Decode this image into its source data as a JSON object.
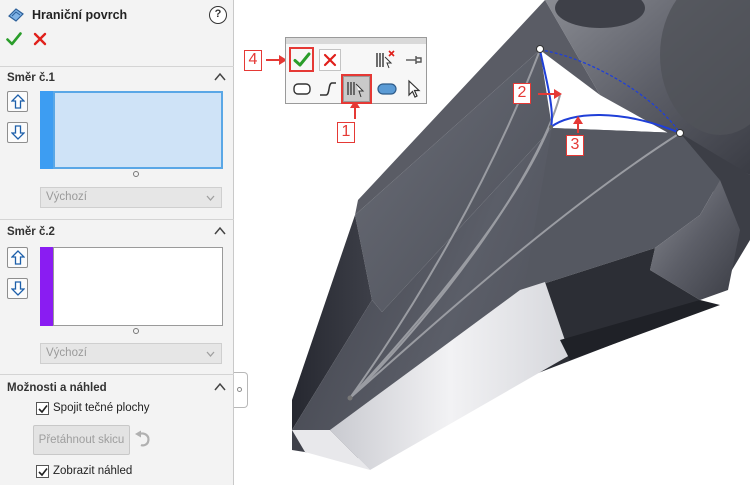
{
  "panel": {
    "title": "Hraniční povrch",
    "help_glyph": "?"
  },
  "direction1": {
    "title": "Směr č.1",
    "color": "#3d9df2",
    "combo_value": "Výchozí"
  },
  "direction2": {
    "title": "Směr č.2",
    "color": "#8a1cf2",
    "combo_value": "Výchozí"
  },
  "options": {
    "title": "Možnosti a náhled",
    "merge_tangent_label": "Spojit tečné plochy",
    "merge_tangent_checked": true,
    "drag_sketch_label": "Přetáhnout skicu",
    "show_preview_label": "Zobrazit náhled",
    "show_preview_checked": true
  },
  "toolbar": {
    "ok_icon": "check-icon",
    "cancel_icon": "x-icon",
    "highlighted_button": "boundary-surface-icon"
  },
  "callouts": [
    "1",
    "2",
    "3",
    "4"
  ],
  "colors": {
    "accent_ok": "#2a9d2a",
    "accent_cancel": "#e0201b",
    "callout_red": "#e53935",
    "boundary_blue": "#1f3fd8"
  }
}
